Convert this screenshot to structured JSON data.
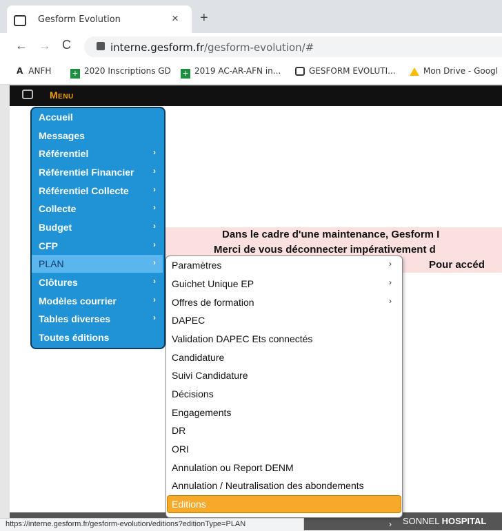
{
  "browser": {
    "tab_title": "Gesform Evolution",
    "tab_close": "×",
    "new_tab": "+",
    "back": "←",
    "forward": "→",
    "reload": "C",
    "url_host": "interne.gesform.fr",
    "url_path": "/gesform-evolution/#",
    "bookmarks": [
      {
        "label": "ANFH",
        "icon": "a-icon"
      },
      {
        "label": "2020 Inscriptions GD",
        "icon": "sheets-icon"
      },
      {
        "label": "2019 AC-AR-AFN in...",
        "icon": "sheets-icon"
      },
      {
        "label": "GESFORM EVOLUTI...",
        "icon": "gesform-icon"
      },
      {
        "label": "Mon Drive - Googl",
        "icon": "drive-icon"
      }
    ]
  },
  "app": {
    "menu_title": "Menu",
    "menu_items": [
      {
        "label": "Accueil",
        "arrow": ""
      },
      {
        "label": "Messages",
        "arrow": ""
      },
      {
        "label": "Référentiel",
        "arrow": "›"
      },
      {
        "label": "Référentiel Financier",
        "arrow": "›"
      },
      {
        "label": "Référentiel Collecte",
        "arrow": "›"
      },
      {
        "label": "Collecte",
        "arrow": "›"
      },
      {
        "label": "Budget",
        "arrow": "›"
      },
      {
        "label": "CFP",
        "arrow": "›"
      },
      {
        "label": "PLAN",
        "arrow": "›"
      },
      {
        "label": "Clôtures",
        "arrow": "›"
      },
      {
        "label": "Modèles courrier",
        "arrow": "›"
      },
      {
        "label": "Tables diverses",
        "arrow": "›"
      },
      {
        "label": "Toutes éditions",
        "arrow": ""
      }
    ],
    "submenu_items": [
      {
        "label": "Paramètres",
        "arrow": "›"
      },
      {
        "label": "Guichet Unique EP",
        "arrow": "›"
      },
      {
        "label": "Offres de formation",
        "arrow": "›"
      },
      {
        "label": "DAPEC",
        "arrow": ""
      },
      {
        "label": "Validation DAPEC Ets connectés",
        "arrow": ""
      },
      {
        "label": "Candidature",
        "arrow": ""
      },
      {
        "label": "Suivi Candidature",
        "arrow": ""
      },
      {
        "label": "Décisions",
        "arrow": ""
      },
      {
        "label": "Engagements",
        "arrow": ""
      },
      {
        "label": "DR",
        "arrow": ""
      },
      {
        "label": "ORI",
        "arrow": ""
      },
      {
        "label": "Annulation ou Report DENM",
        "arrow": ""
      },
      {
        "label": "Annulation / Neutralisation des abondements",
        "arrow": ""
      },
      {
        "label": "Editions",
        "arrow": ""
      }
    ],
    "sub_extra_arrow": "›",
    "alert_lines": [
      "Dans le cadre d'une maintenance, Gesform I",
      "Merci de vous déconnecter impérativement d",
      "Pour accéd"
    ],
    "footer_prefix": "SONNEL ",
    "footer_bold": "HOSPITAL",
    "status_url": "https://interne.gesform.fr/gesform-evolution/editions?editionType=PLAN"
  }
}
